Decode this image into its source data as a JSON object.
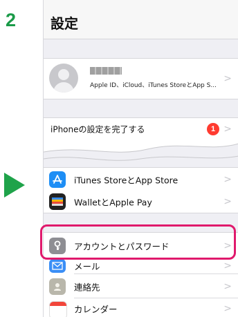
{
  "step": "2",
  "nav": {
    "title": "設定"
  },
  "profile": {
    "subtitle": "Apple ID、iCloud、iTunes StoreとApp S..."
  },
  "setup": {
    "label": "iPhoneの設定を完了する",
    "badge": "1"
  },
  "menu": [
    {
      "label": "iTunes StoreとApp Store",
      "icon": "app-store-icon",
      "color": "#1e8ef5"
    },
    {
      "label": "WalletとApple Pay",
      "icon": "wallet-icon",
      "color": "#222222"
    },
    {
      "label": "アカウントとパスワード",
      "icon": "key-icon",
      "color": "#8e8e93"
    },
    {
      "label": "メール",
      "icon": "mail-icon",
      "color": "#3a8ef6"
    },
    {
      "label": "連絡先",
      "icon": "contacts-icon",
      "color": "#b9b7ab"
    },
    {
      "label": "カレンダー",
      "icon": "calendar-icon",
      "color": "#f2453a"
    }
  ],
  "chevron": ">",
  "colors": {
    "step": "#1a9a48",
    "arrow": "#1fa34a",
    "highlight": "#e0196c",
    "badge": "#ff3b30"
  }
}
